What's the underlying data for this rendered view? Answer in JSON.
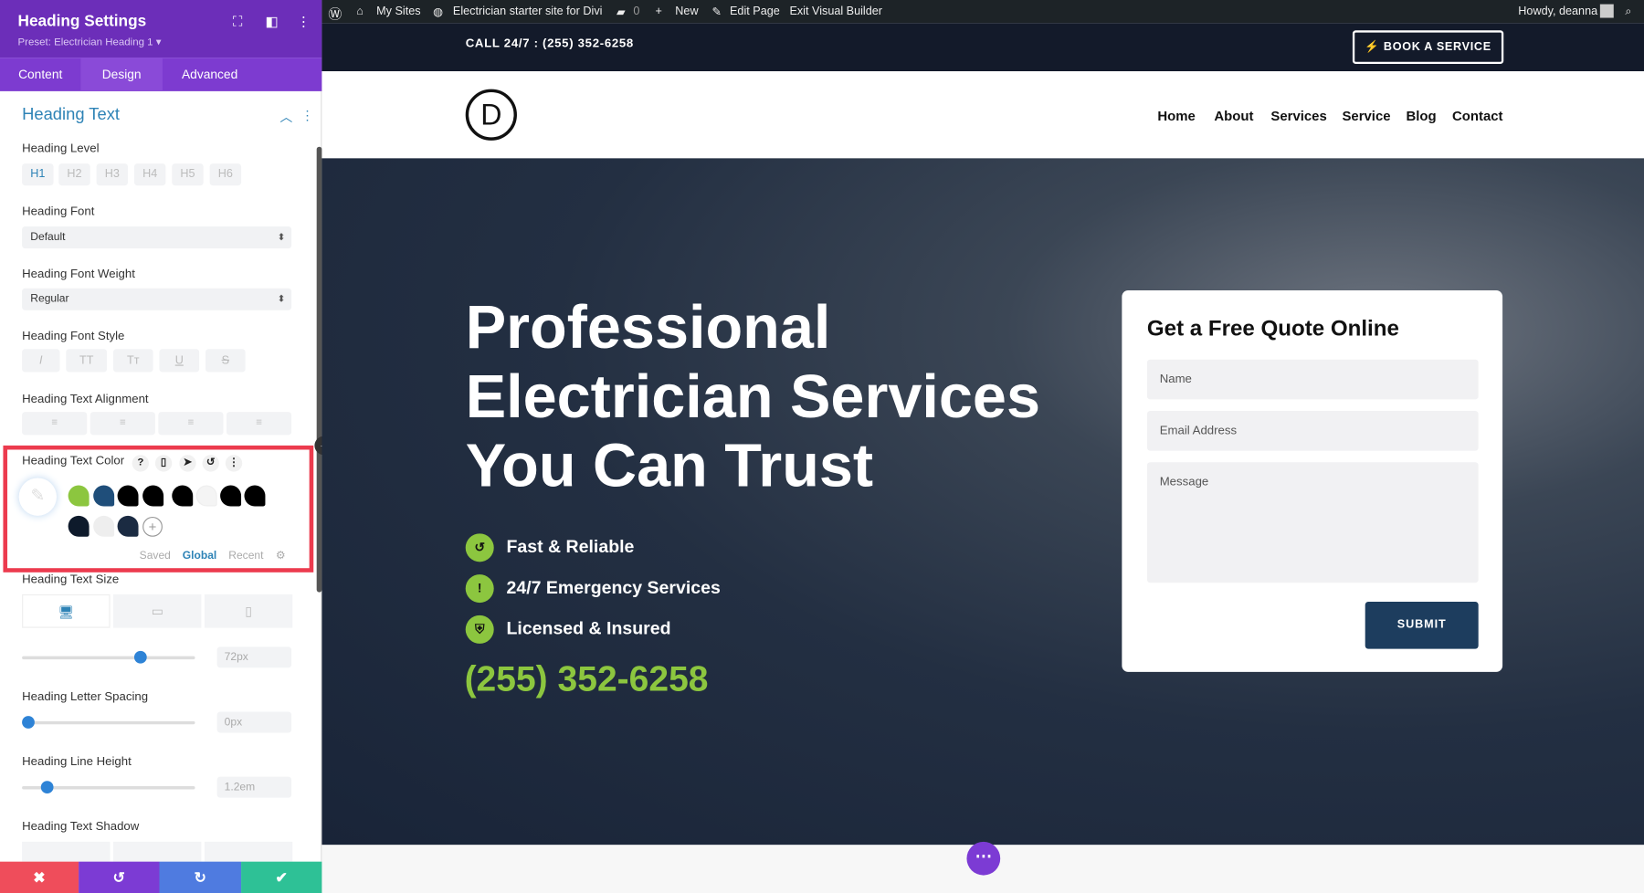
{
  "panel": {
    "title": "Heading Settings",
    "preset": "Preset: Electrician Heading 1 ▾",
    "tabs": [
      "Content",
      "Design",
      "Advanced"
    ],
    "active_tab": "Design",
    "section": "Heading Text",
    "heading_level": {
      "label": "Heading Level",
      "options": [
        "H1",
        "H2",
        "H3",
        "H4",
        "H5",
        "H6"
      ],
      "selected": "H1"
    },
    "font": {
      "label": "Heading Font",
      "value": "Default"
    },
    "weight": {
      "label": "Heading Font Weight",
      "value": "Regular"
    },
    "style": {
      "label": "Heading Font Style",
      "options": [
        "I",
        "TT",
        "Tт",
        "U",
        "S"
      ]
    },
    "alignment": {
      "label": "Heading Text Alignment"
    },
    "color": {
      "label": "Heading Text Color",
      "swatches": [
        "#8cc63f",
        "#1f4e7a",
        "#000000",
        "#000000",
        "#000000",
        "#f4f4f4",
        "#000000",
        "#000000",
        "#0e1a2b",
        "#eeeeee",
        "#1b2b42"
      ],
      "tabs": [
        "Saved",
        "Global",
        "Recent"
      ],
      "active": "Global"
    },
    "size": {
      "label": "Heading Text Size",
      "value": "72px",
      "slider": 0.7
    },
    "letter_spacing": {
      "label": "Heading Letter Spacing",
      "value": "0px",
      "slider": 0.0
    },
    "line_height": {
      "label": "Heading Line Height",
      "value": "1.2em",
      "slider": 0.12
    },
    "shadow": {
      "label": "Heading Text Shadow"
    }
  },
  "adminbar": {
    "my_sites": "My Sites",
    "site": "Electrician starter site for Divi",
    "comments": "0",
    "new": "New",
    "edit": "Edit Page",
    "exit": "Exit Visual Builder",
    "howdy": "Howdy, deanna"
  },
  "site": {
    "call": "CALL 24/7 : (255) 352-6258",
    "book": "BOOK A SERVICE",
    "logo": "D",
    "nav": [
      "Home",
      "About",
      "Services",
      "Service",
      "Blog",
      "Contact"
    ],
    "hero_lines": [
      "Professional",
      "Electrician Services",
      "You Can Trust"
    ],
    "features": [
      "Fast & Reliable",
      "24/7 Emergency Services",
      "Licensed & Insured"
    ],
    "phone": "(255) 352-6258",
    "form": {
      "title": "Get a Free Quote Online",
      "name": "Name",
      "email": "Email Address",
      "message": "Message",
      "submit": "SUBMIT"
    }
  },
  "colors": {
    "accent": "#8cc63f",
    "purple": "#6c2eb9",
    "navy": "#1d3d5e",
    "highlight": "#ec3b4e"
  }
}
